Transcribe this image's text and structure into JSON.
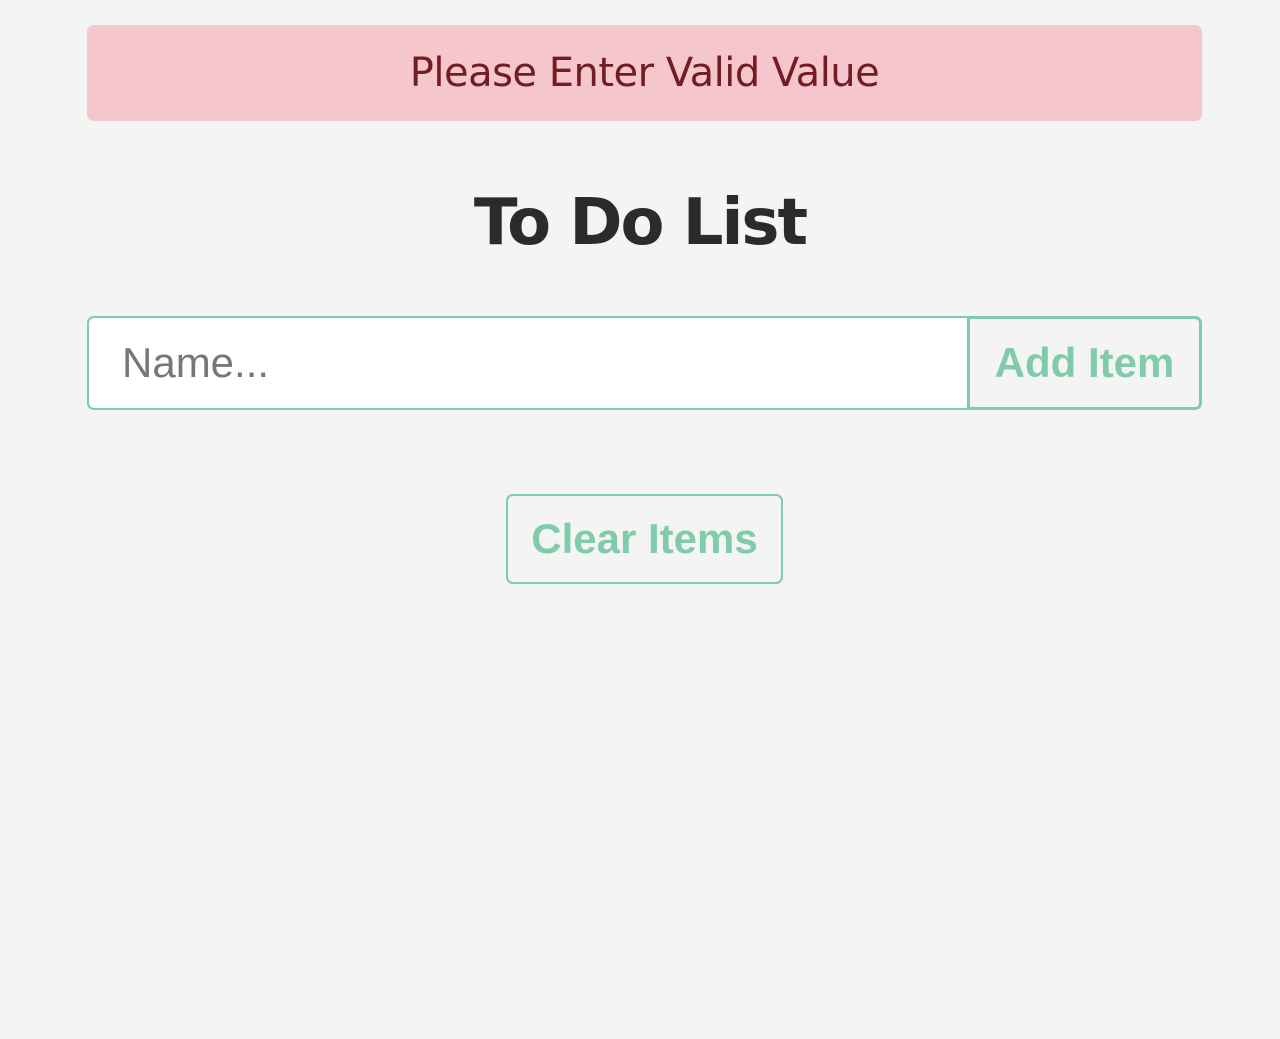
{
  "alert": {
    "message": "Please Enter Valid Value"
  },
  "page": {
    "title": "To Do List"
  },
  "form": {
    "name_placeholder": "Name...",
    "name_value": "",
    "add_label": "Add Item"
  },
  "actions": {
    "clear_label": "Clear Items"
  },
  "colors": {
    "background": "#f4f4f4",
    "alert_bg": "#f5c6cb",
    "alert_text": "#721c24",
    "accent": "#80ccaa",
    "title_text": "#2b2b2b"
  }
}
